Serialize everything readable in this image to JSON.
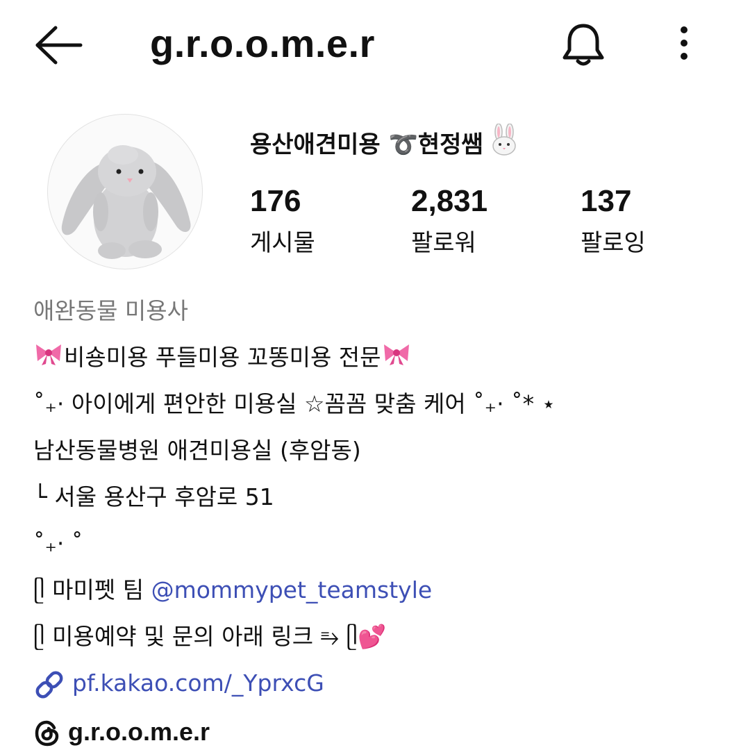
{
  "header": {
    "username": "g.r.o.o.m.e.r"
  },
  "icons": {
    "back": "arrow-left-icon",
    "notifications": "bell-icon",
    "more": "more-vertical-icon",
    "link": "link-icon",
    "threads": "threads-icon"
  },
  "profile": {
    "display_name": "용산애견미용 ➰현정쌤",
    "avatar_subject": "grey bunny plush",
    "stats": [
      {
        "count": "176",
        "label": "게시물"
      },
      {
        "count": "2,831",
        "label": "팔로워"
      },
      {
        "count": "137",
        "label": "팔로잉"
      }
    ]
  },
  "bio": {
    "category": "애완동물 미용사",
    "line1_text": "비숑미용 푸들미용 꼬똥미용 전문",
    "line2": "˚₊· 아이에게 편안한 미용실 ☆꼼꼼 맞춤 케어 ˚₊· ˚* ⋆",
    "line3": "남산동물병원 애견미용실 (후암동)",
    "line4": " └ 서울 용산구 후암로 51",
    "line5": "˚₊· ˚",
    "line6_prefix": "ᥫ 마미펫 팀 ",
    "line6_mention": "@mommypet_teamstyle",
    "line7": "ᥫ 미용예약 및 문의 아래 링크 ⥱ ᥫ💕",
    "link": "pf.kakao.com/_YprxcG"
  },
  "threads": {
    "handle": "g.r.o.o.m.e.r"
  },
  "colors": {
    "link": "#3d4fb5",
    "category_text": "#777777",
    "bow": "#f06aa8"
  }
}
